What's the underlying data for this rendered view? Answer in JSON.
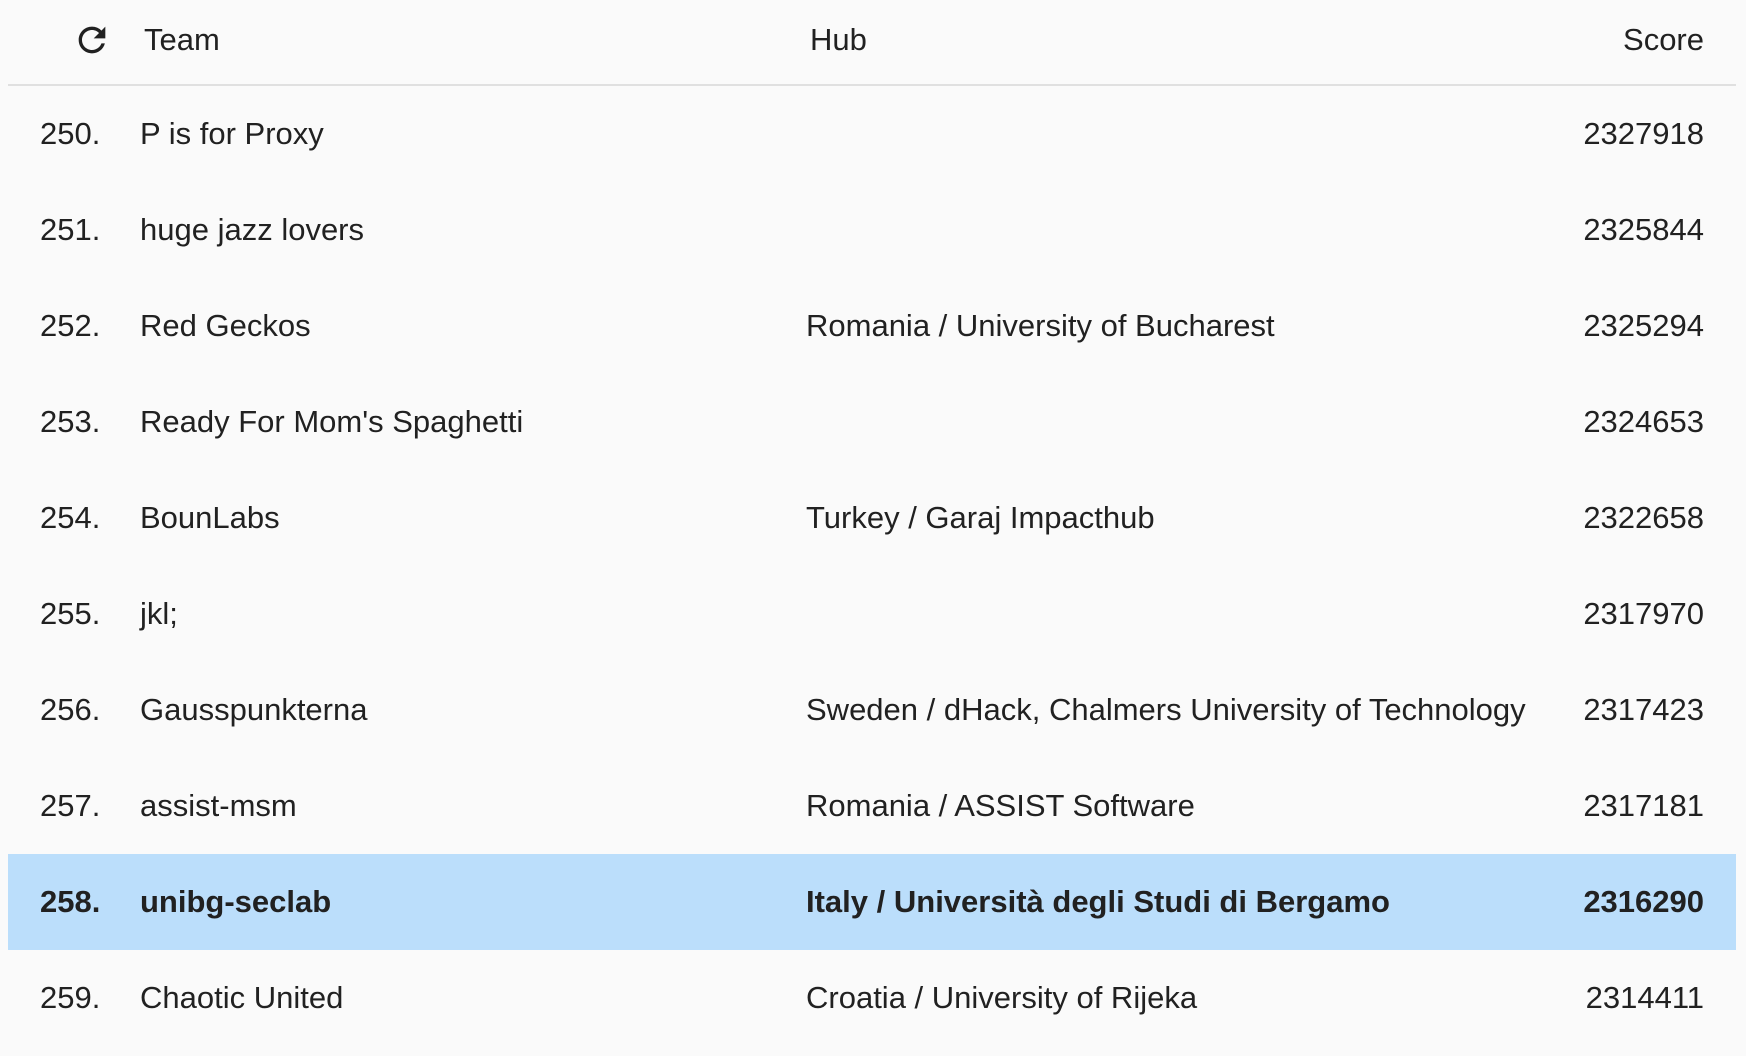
{
  "header": {
    "refresh_icon": "refresh-icon",
    "team_label": "Team",
    "hub_label": "Hub",
    "score_label": "Score"
  },
  "colors": {
    "highlight_row": "#bbdefb",
    "background": "#fafafa",
    "divider": "#e0e0e0"
  },
  "rows": [
    {
      "rank": "250.",
      "team": "P is for Proxy",
      "hub": "",
      "score": "2327918",
      "highlight": false
    },
    {
      "rank": "251.",
      "team": "huge jazz lovers",
      "hub": "",
      "score": "2325844",
      "highlight": false
    },
    {
      "rank": "252.",
      "team": "Red Geckos",
      "hub": "Romania / University of Bucharest",
      "score": "2325294",
      "highlight": false
    },
    {
      "rank": "253.",
      "team": "Ready For Mom's Spaghetti",
      "hub": "",
      "score": "2324653",
      "highlight": false
    },
    {
      "rank": "254.",
      "team": "BounLabs",
      "hub": "Turkey / Garaj Impacthub",
      "score": "2322658",
      "highlight": false
    },
    {
      "rank": "255.",
      "team": "jkl;",
      "hub": "",
      "score": "2317970",
      "highlight": false
    },
    {
      "rank": "256.",
      "team": "Gausspunkterna",
      "hub": "Sweden / dHack, Chalmers University of Technology",
      "score": "2317423",
      "highlight": false
    },
    {
      "rank": "257.",
      "team": "assist-msm",
      "hub": "Romania / ASSIST Software",
      "score": "2317181",
      "highlight": false
    },
    {
      "rank": "258.",
      "team": "unibg-seclab",
      "hub": "Italy / Università degli Studi di Bergamo",
      "score": "2316290",
      "highlight": true
    },
    {
      "rank": "259.",
      "team": "Chaotic United",
      "hub": "Croatia / University of Rijeka",
      "score": "2314411",
      "highlight": false
    }
  ]
}
